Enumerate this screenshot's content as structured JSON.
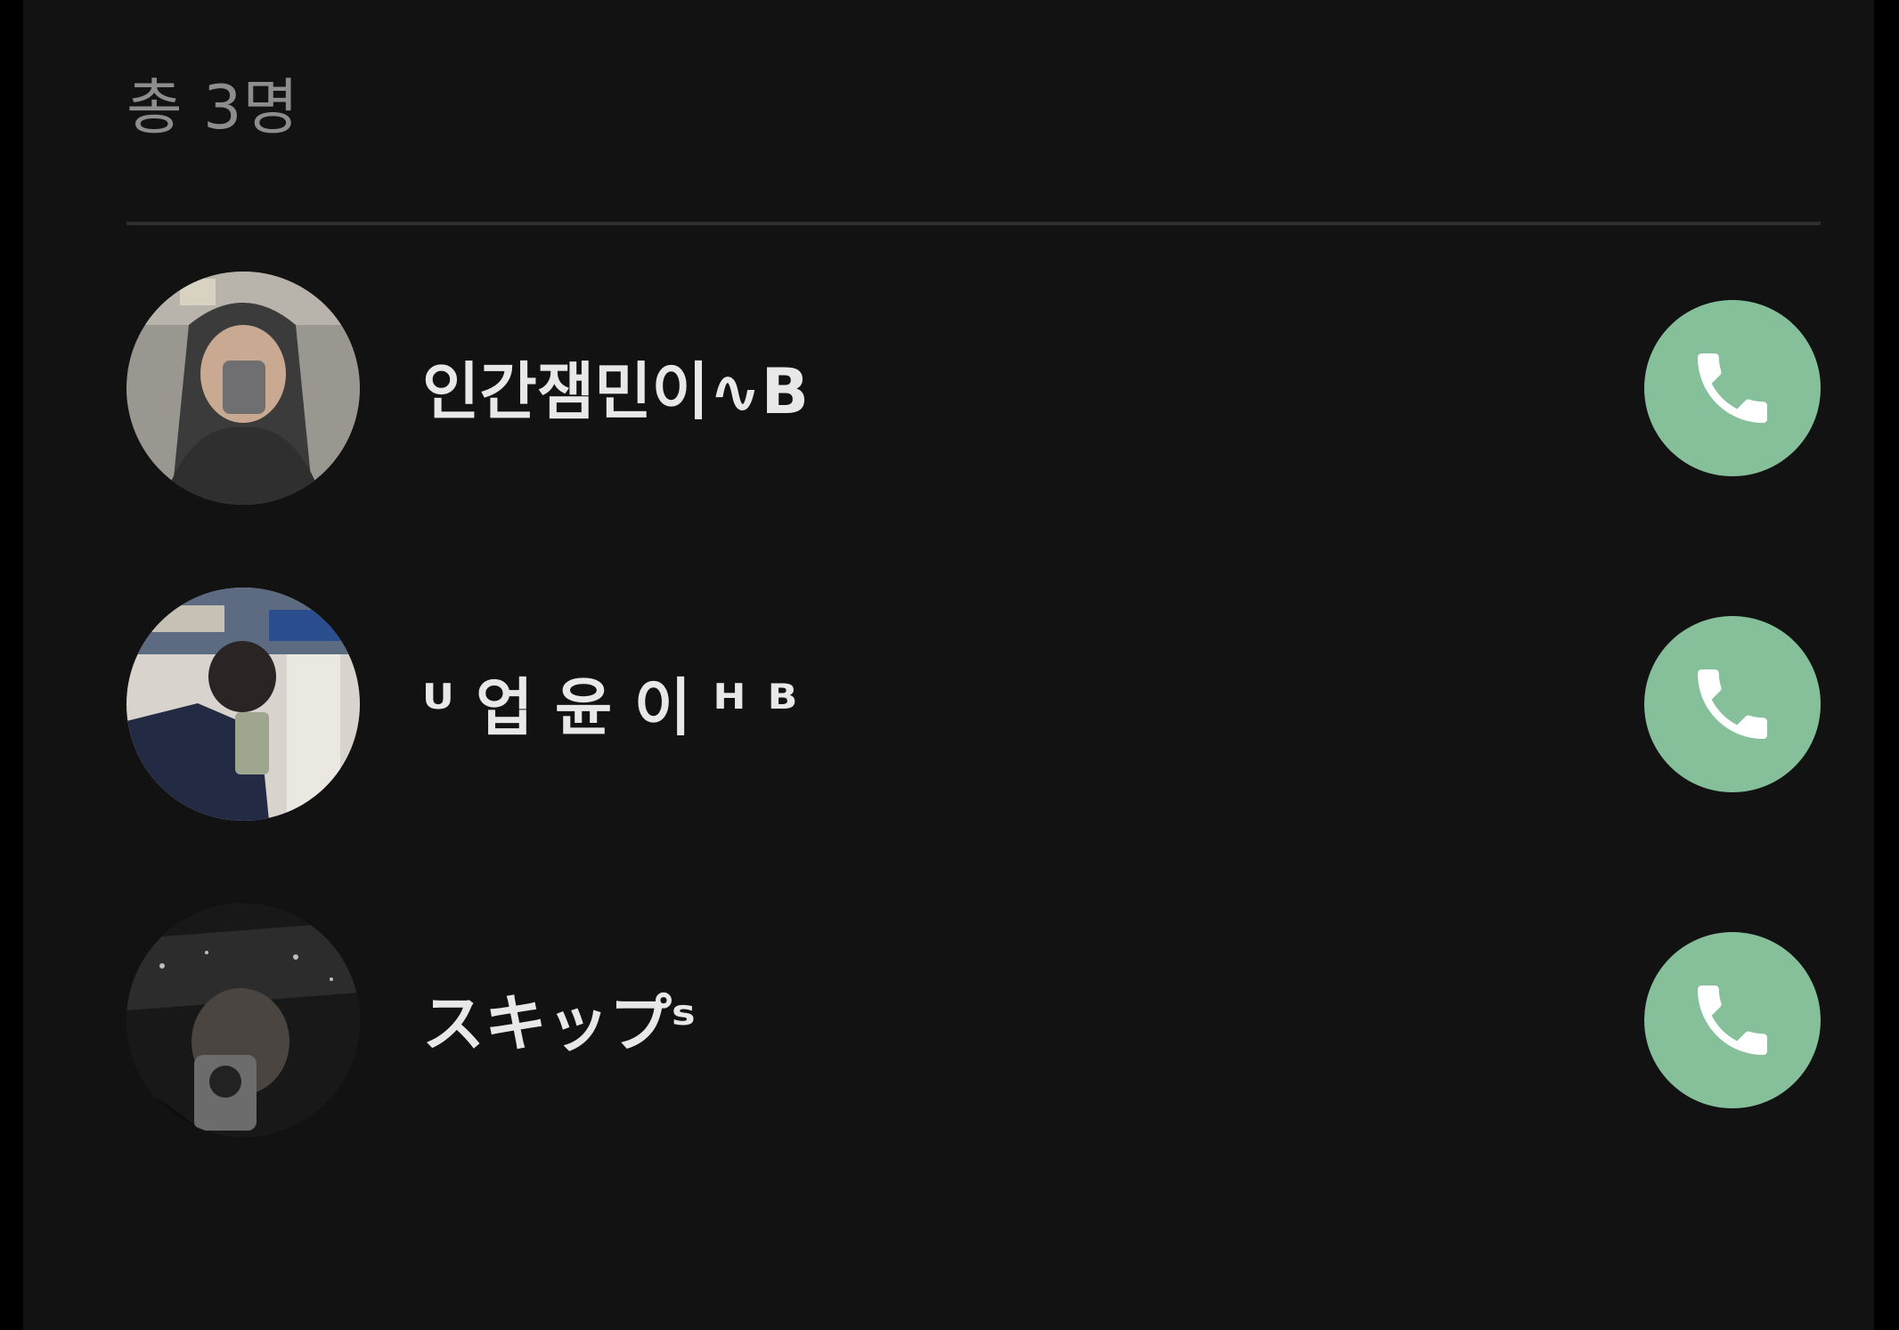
{
  "header": {
    "count_label": "총 3명"
  },
  "members": [
    {
      "name": "인간잼민이∿B"
    },
    {
      "name": "ᵁ 업 윤 이 ᴴ ᴮ"
    },
    {
      "name": "スキップˢ"
    }
  ],
  "colors": {
    "panel_background": "#121212",
    "call_button": "#86c09b",
    "count_text": "#8d8d8d",
    "name_text": "#e8e8e8",
    "divider": "#2f2f2f"
  },
  "icons": {
    "call_button": "phone-icon"
  }
}
